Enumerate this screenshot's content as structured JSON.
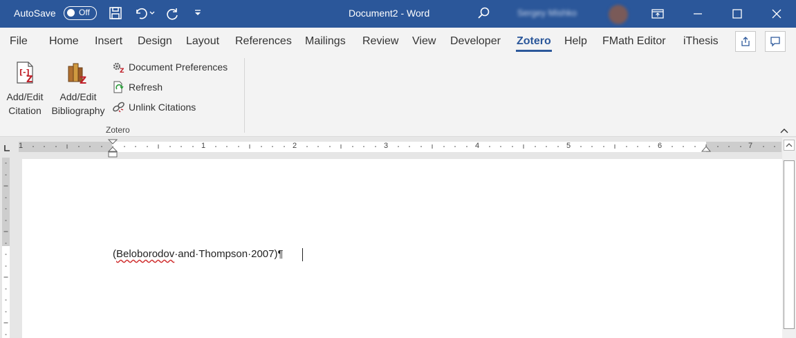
{
  "titlebar": {
    "autosave_label": "AutoSave",
    "autosave_state": "Off",
    "document_title": "Document2  -  Word",
    "user_name": "Sergey Mishko"
  },
  "tabs": [
    "File",
    "Home",
    "Insert",
    "Design",
    "Layout",
    "References",
    "Mailings",
    "Review",
    "View",
    "Developer",
    "Zotero",
    "Help",
    "FMath Editor",
    "iThesis"
  ],
  "active_tab": "Zotero",
  "ribbon": {
    "add_edit_citation": [
      "Add/Edit",
      "Citation"
    ],
    "add_edit_bibliography": [
      "Add/Edit",
      "Bibliography"
    ],
    "document_preferences": "Document Preferences",
    "refresh": "Refresh",
    "unlink_citations": "Unlink Citations",
    "group_label": "Zotero"
  },
  "ruler": {
    "numbers": [
      "1",
      "1",
      "2",
      "3",
      "4",
      "5",
      "6",
      "7"
    ]
  },
  "document": {
    "citation_open": "(",
    "citation_author": "Beloborodov",
    "citation_rest": "·and·Thompson·2007)",
    "pilcrow": "¶"
  },
  "colors": {
    "titlebar": "#2b579a",
    "accent": "#2b579a",
    "zotero_red": "#c0202a"
  }
}
